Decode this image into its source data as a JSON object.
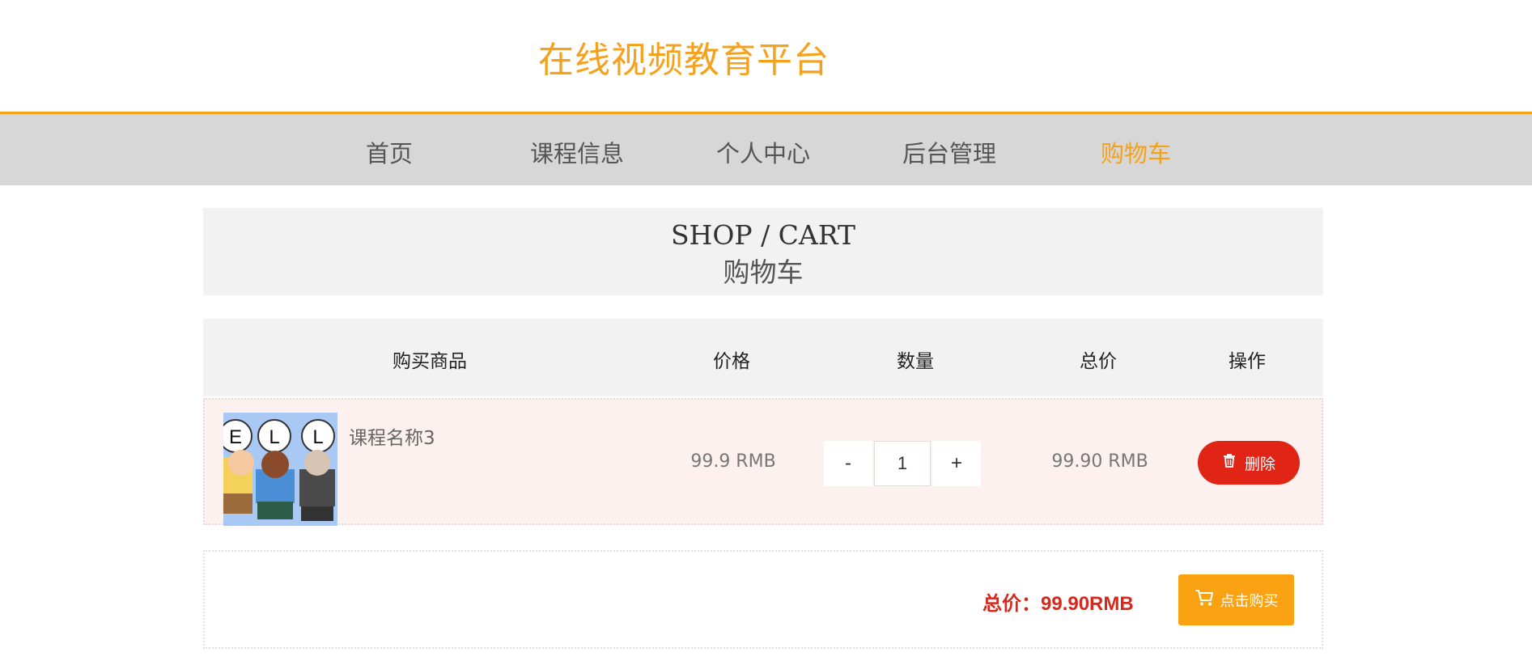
{
  "header": {
    "site_title": "在线视频教育平台"
  },
  "nav": {
    "items": [
      {
        "label": "首页"
      },
      {
        "label": "课程信息"
      },
      {
        "label": "个人中心"
      },
      {
        "label": "后台管理"
      },
      {
        "label": "购物车",
        "active": true
      }
    ]
  },
  "banner": {
    "title_en": "SHOP / CART",
    "title_zh": "购物车"
  },
  "table": {
    "headers": [
      "购买商品",
      "价格",
      "数量",
      "总价",
      "操作"
    ],
    "rows": [
      {
        "course_name": "课程名称3",
        "thumbnail_letters": [
          "E",
          "L",
          "L"
        ],
        "unit_price": "99.9 RMB",
        "quantity": "1",
        "minus_label": "-",
        "plus_label": "+",
        "line_total": "99.90 RMB",
        "delete_label": "删除"
      }
    ]
  },
  "checkout": {
    "total_text": "总价：99.90RMB",
    "buy_label": "点击购买"
  },
  "colors": {
    "accent_orange": "#f5a11c",
    "nav_bg": "#d7d7d7",
    "delete_red": "#e02416",
    "total_red": "#d9271d",
    "buy_orange": "#fba212"
  }
}
